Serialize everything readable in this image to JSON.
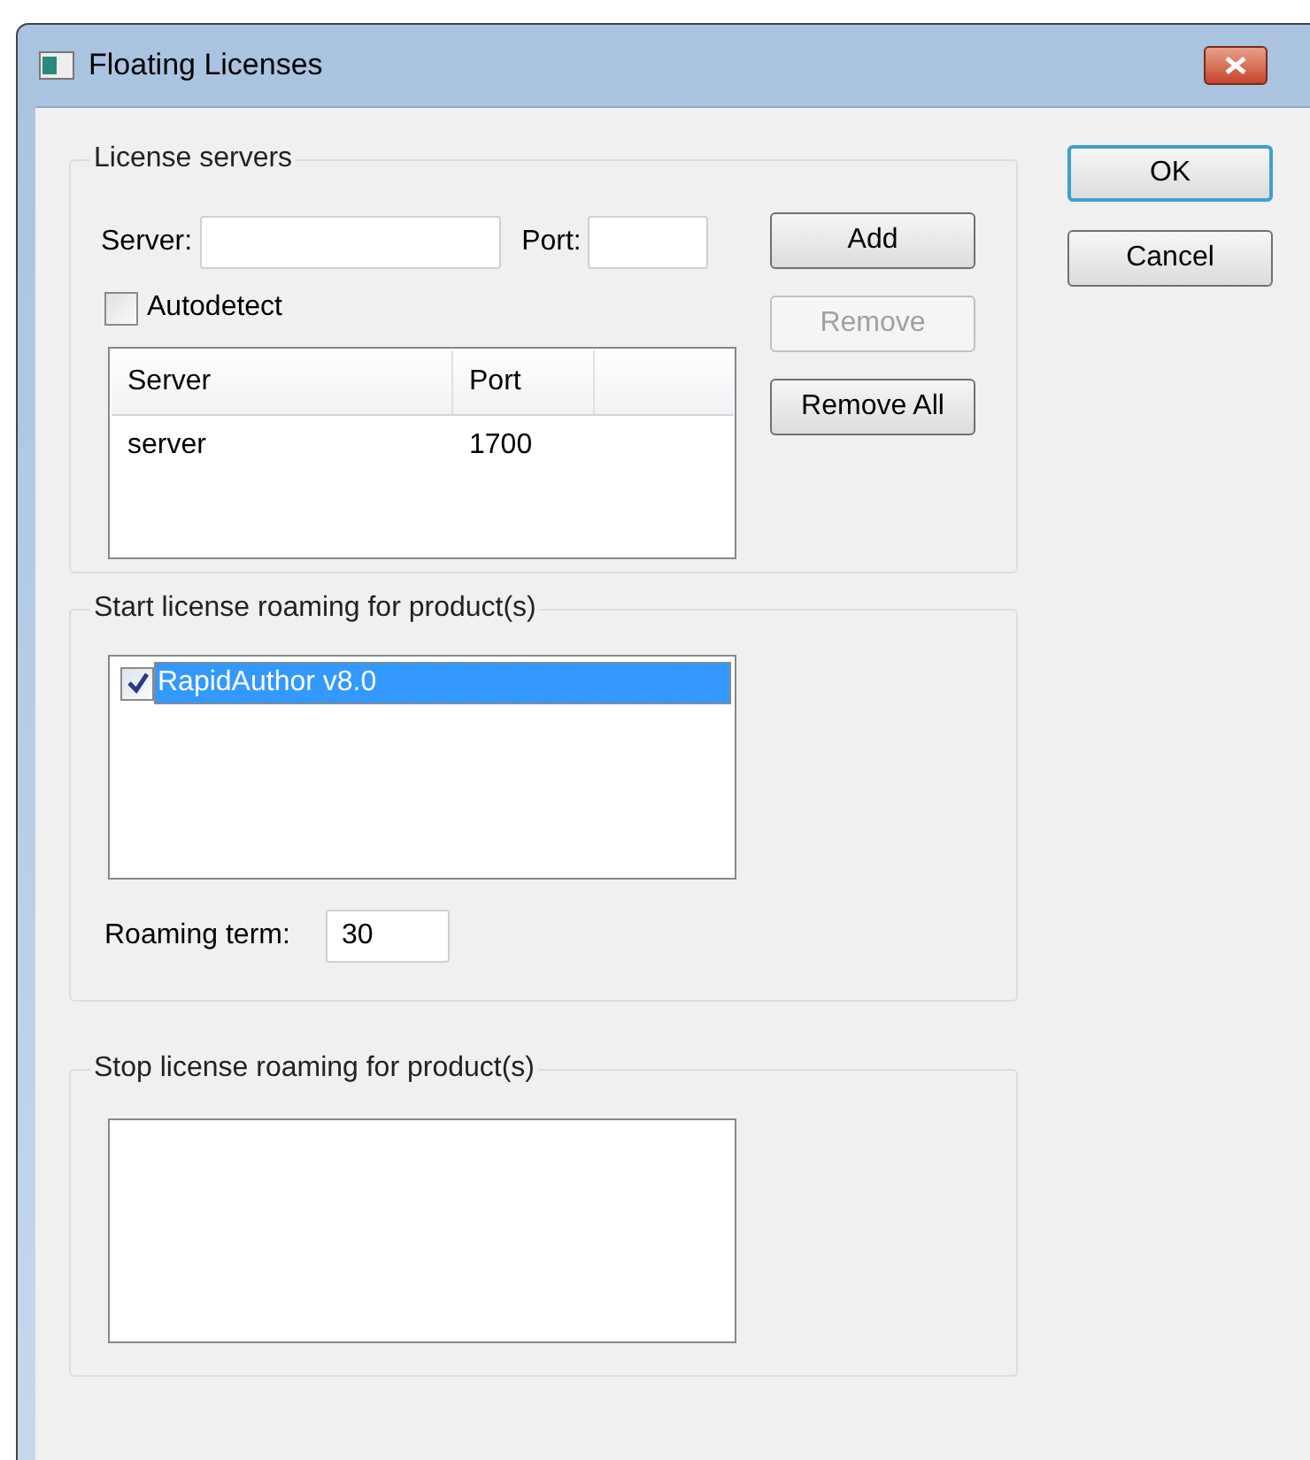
{
  "window": {
    "title": "Floating Licenses"
  },
  "license_servers": {
    "title": "License servers",
    "server_label": "Server:",
    "port_label": "Port:",
    "autodetect": {
      "label": "Autodetect",
      "checked": false
    },
    "table": {
      "columns": [
        "Server",
        "Port"
      ],
      "rows": [
        {
          "server": "server",
          "port": "1700"
        }
      ]
    },
    "buttons": [
      {
        "label": "Add",
        "disabled": false
      },
      {
        "label": "Remove",
        "disabled": true
      },
      {
        "label": "Remove All",
        "disabled": false
      }
    ]
  },
  "start_roaming": {
    "title": "Start license roaming for product(s)",
    "products": [
      {
        "label": "RapidAuthor v8.0",
        "checked": true,
        "selected": true
      }
    ],
    "term_label": "Roaming term:",
    "term_value": "30"
  },
  "stop_roaming": {
    "title": "Stop license roaming for product(s)"
  },
  "dialog_buttons": [
    {
      "label": "OK",
      "default": true
    },
    {
      "label": "Cancel",
      "default": false
    }
  ]
}
